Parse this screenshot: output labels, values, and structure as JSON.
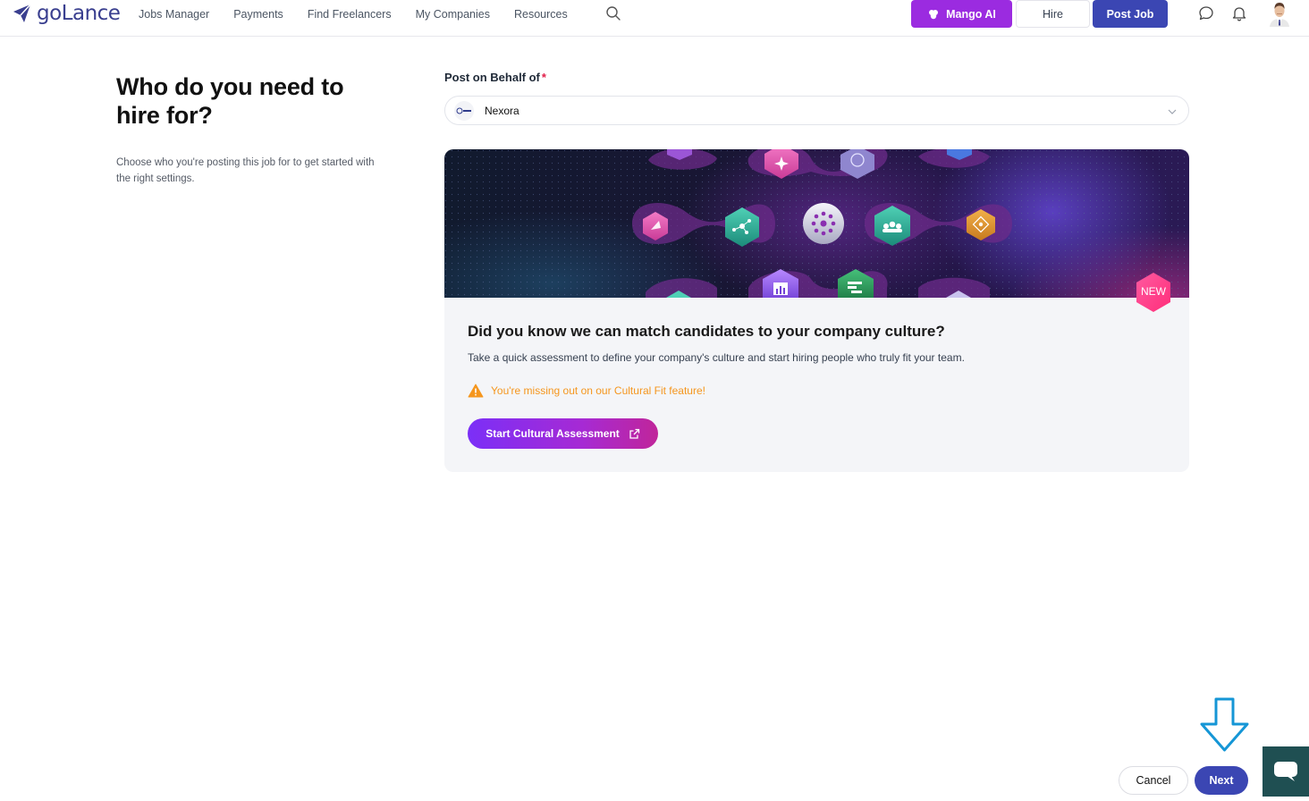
{
  "nav": {
    "logo_text": "goLance",
    "items": [
      {
        "label": "Jobs Manager"
      },
      {
        "label": "Payments"
      },
      {
        "label": "Find Freelancers"
      },
      {
        "label": "My Companies"
      },
      {
        "label": "Resources"
      }
    ],
    "mango_label": "Mango AI",
    "hire_label": "Hire",
    "post_job_label": "Post Job"
  },
  "left": {
    "title": "Who do you need to hire for?",
    "description": "Choose who you're posting this job for to get started with the right settings."
  },
  "form": {
    "label": "Post on Behalf of",
    "required_mark": "*",
    "selected_company": "Nexora"
  },
  "card": {
    "badge": "NEW",
    "title": "Did you know we can match candidates to your company culture?",
    "description": "Take a quick assessment to define your company's culture and start hiring people who truly fit your team.",
    "warning": "You're missing out on our Cultural Fit feature!",
    "button_label": "Start Cultural Assessment"
  },
  "footer": {
    "cancel_label": "Cancel",
    "next_label": "Next"
  },
  "colors": {
    "primary": "#3b46b3",
    "mango": "#9b2be0",
    "warning": "#f5961e",
    "badge": "#ff3d8b",
    "arrow": "#1596d6"
  }
}
